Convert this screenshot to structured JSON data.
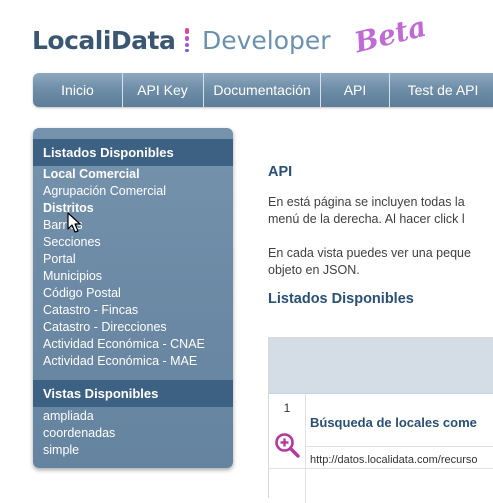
{
  "logo": {
    "part1": "LocaliData",
    "part2": "Developer",
    "badge": "Beta",
    "sep_colors": [
      "#e0459a",
      "#c24fc6",
      "#9a59d6",
      "#7063d2"
    ]
  },
  "topnav": {
    "items": [
      {
        "label": "Inicio"
      },
      {
        "label": "API Key"
      },
      {
        "label": "Documentación"
      },
      {
        "label": "API"
      },
      {
        "label": "Test de API"
      }
    ]
  },
  "sidebar": {
    "section1_title": "Listados Disponibles",
    "section1_items": [
      {
        "label": "Local Comercial"
      },
      {
        "label": "Agrupación Comercial"
      },
      {
        "label": "Distritos"
      },
      {
        "label": "Barrios"
      },
      {
        "label": "Secciones"
      },
      {
        "label": "Portal"
      },
      {
        "label": "Municipios"
      },
      {
        "label": "Código Postal"
      },
      {
        "label": "Catastro - Fincas"
      },
      {
        "label": "Catastro - Direcciones"
      },
      {
        "label": "Actividad Económica - CNAE"
      },
      {
        "label": "Actividad Económica - MAE"
      }
    ],
    "section2_title": "Vistas Disponibles",
    "section2_items": [
      {
        "label": "ampliada"
      },
      {
        "label": "coordenadas"
      },
      {
        "label": "simple"
      }
    ]
  },
  "main": {
    "title": "API",
    "para1_line1": "En está página se incluyen todas la",
    "para1_line2": "menú de la derecha. Al hacer click l",
    "para2_line1": "En cada vista puedes ver una peque",
    "para2_line2": "objeto en JSON.",
    "section_title": "Listados Disponibles",
    "table": {
      "row_number": "1",
      "row_title": "Búsqueda de locales come",
      "row_url": "http://datos.localidata.com/recurso"
    }
  },
  "colors": {
    "nav_text": "#ffffff",
    "heading": "#2a4f75",
    "sidebar_header": "#3d6183",
    "zoom_icon": "#b23a9c"
  }
}
